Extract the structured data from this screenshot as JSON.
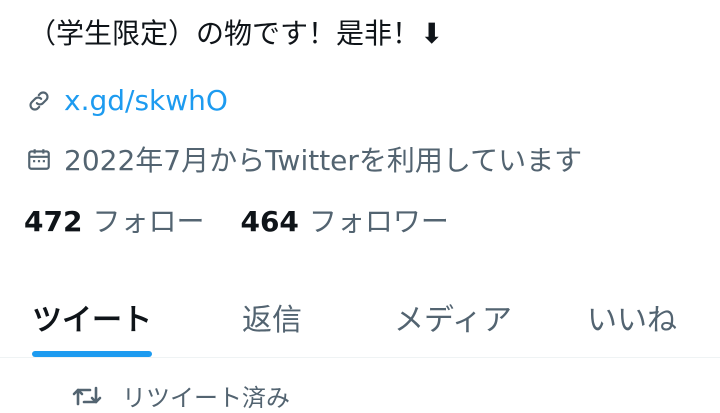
{
  "profile": {
    "bio_tail": "（学生限定）の物です！是非！⬇",
    "link": "x.gd/skwhO",
    "joined": "2022年7月からTwitterを利用しています",
    "following_count": "472",
    "following_label": "フォロー",
    "followers_count": "464",
    "followers_label": "フォロワー",
    "icons": {
      "link": "link-icon",
      "calendar": "calendar-icon"
    }
  },
  "tabs": [
    {
      "label": "ツイート",
      "active": true
    },
    {
      "label": "返信",
      "active": false
    },
    {
      "label": "メディア",
      "active": false
    },
    {
      "label": "いいね",
      "active": false
    }
  ],
  "timeline": {
    "retweet_label": "リツイート済み",
    "icon": "retweet-icon"
  },
  "colors": {
    "accent": "#1d9bf0",
    "muted": "#536471",
    "text": "#0f1419"
  }
}
